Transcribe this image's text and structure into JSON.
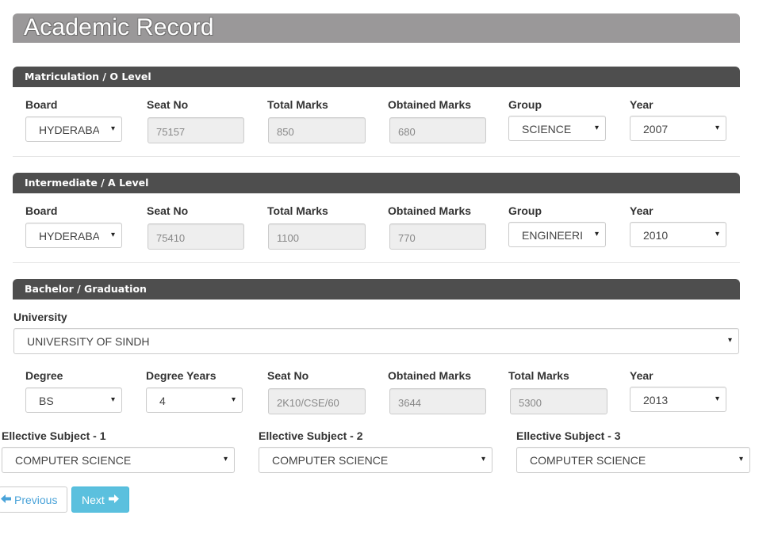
{
  "page": {
    "title": "Academic Record"
  },
  "sections": {
    "matric": {
      "title": "Matriculation / O Level",
      "labels": {
        "board": "Board",
        "seat": "Seat No",
        "total": "Total Marks",
        "obtained": "Obtained Marks",
        "group": "Group",
        "year": "Year"
      },
      "values": {
        "board": "HYDERABA",
        "seat": "75157",
        "total": "850",
        "obtained": "680",
        "group": "SCIENCE",
        "year": "2007"
      }
    },
    "inter": {
      "title": "Intermediate / A Level",
      "labels": {
        "board": "Board",
        "seat": "Seat No",
        "total": "Total Marks",
        "obtained": "Obtained Marks",
        "group": "Group",
        "year": "Year"
      },
      "values": {
        "board": "HYDERABA",
        "seat": "75410",
        "total": "1100",
        "obtained": "770",
        "group": "ENGINEERI",
        "year": "2010"
      }
    },
    "bachelor": {
      "title": "Bachelor / Graduation",
      "labels": {
        "university": "University",
        "degree": "Degree",
        "degree_years": "Degree Years",
        "seat": "Seat No",
        "obtained": "Obtained Marks",
        "total": "Total Marks",
        "year": "Year"
      },
      "values": {
        "university": "UNIVERSITY OF SINDH",
        "degree": "BS",
        "degree_years": "4",
        "seat": "2K10/CSE/60",
        "obtained": "3644",
        "total": "5300",
        "year": "2013"
      }
    }
  },
  "electives": {
    "labels": [
      "Ellective Subject - 1",
      "Ellective Subject - 2",
      "Ellective Subject - 3"
    ],
    "values": [
      "COMPUTER SCIENCE",
      "COMPUTER SCIENCE",
      "COMPUTER SCIENCE"
    ]
  },
  "buttons": {
    "previous": "Previous",
    "next": "Next"
  },
  "icons": {
    "dropdown": "▾",
    "previous": "arrow-left-icon",
    "next": "arrow-right-icon"
  },
  "colors": {
    "header": "#9a9899",
    "section_bar": "#4e4e4e",
    "next_button": "#5bc0de",
    "link": "#4aa3d9"
  }
}
